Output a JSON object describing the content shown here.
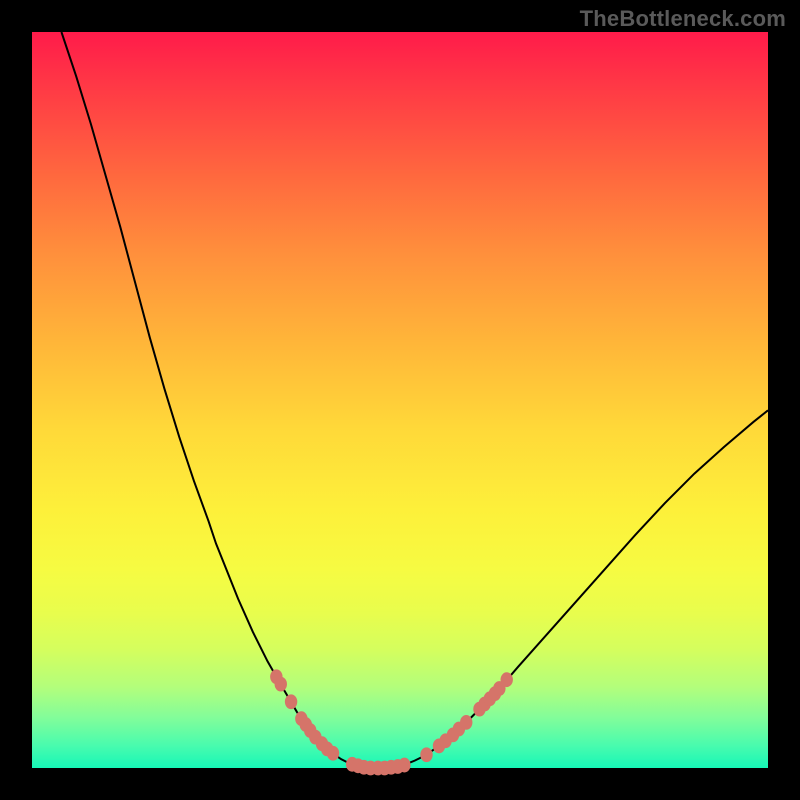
{
  "watermark": "TheBottleneck.com",
  "colors": {
    "marker": "#d57469",
    "curve": "#000000",
    "frame_bg_top": "#ff1b4a",
    "frame_bg_bottom": "#16f7b7",
    "page_bg": "#000000"
  },
  "chart_data": {
    "type": "line",
    "title": "",
    "xlabel": "",
    "ylabel": "",
    "xlim": [
      0,
      100
    ],
    "ylim": [
      0,
      100
    ],
    "grid": false,
    "curve_points": [
      {
        "x": 4.0,
        "y": 100.0
      },
      {
        "x": 6.0,
        "y": 94.0
      },
      {
        "x": 8.0,
        "y": 87.5
      },
      {
        "x": 10.0,
        "y": 80.5
      },
      {
        "x": 12.0,
        "y": 73.5
      },
      {
        "x": 14.0,
        "y": 66.0
      },
      {
        "x": 16.0,
        "y": 58.5
      },
      {
        "x": 18.0,
        "y": 51.5
      },
      {
        "x": 20.0,
        "y": 45.0
      },
      {
        "x": 22.0,
        "y": 39.0
      },
      {
        "x": 24.0,
        "y": 33.5
      },
      {
        "x": 25.0,
        "y": 30.5
      },
      {
        "x": 26.0,
        "y": 28.0
      },
      {
        "x": 28.0,
        "y": 23.0
      },
      {
        "x": 30.0,
        "y": 18.5
      },
      {
        "x": 32.0,
        "y": 14.5
      },
      {
        "x": 34.0,
        "y": 11.0
      },
      {
        "x": 35.0,
        "y": 9.3
      },
      {
        "x": 36.0,
        "y": 7.6
      },
      {
        "x": 37.0,
        "y": 6.2
      },
      {
        "x": 38.0,
        "y": 4.8
      },
      {
        "x": 39.0,
        "y": 3.7
      },
      {
        "x": 40.0,
        "y": 2.7
      },
      {
        "x": 41.0,
        "y": 1.9
      },
      {
        "x": 42.0,
        "y": 1.2
      },
      {
        "x": 43.0,
        "y": 0.7
      },
      {
        "x": 44.0,
        "y": 0.3
      },
      {
        "x": 45.0,
        "y": 0.1
      },
      {
        "x": 46.0,
        "y": 0.0
      },
      {
        "x": 47.5,
        "y": 0.0
      },
      {
        "x": 49.0,
        "y": 0.1
      },
      {
        "x": 50.0,
        "y": 0.3
      },
      {
        "x": 51.0,
        "y": 0.6
      },
      {
        "x": 52.0,
        "y": 1.0
      },
      {
        "x": 53.0,
        "y": 1.5
      },
      {
        "x": 54.0,
        "y": 2.1
      },
      {
        "x": 55.0,
        "y": 2.8
      },
      {
        "x": 57.0,
        "y": 4.4
      },
      {
        "x": 58.0,
        "y": 5.3
      },
      {
        "x": 59.0,
        "y": 6.2
      },
      {
        "x": 60.0,
        "y": 7.2
      },
      {
        "x": 61.0,
        "y": 8.2
      },
      {
        "x": 62.0,
        "y": 9.2
      },
      {
        "x": 63.0,
        "y": 10.2
      },
      {
        "x": 66.0,
        "y": 13.7
      },
      {
        "x": 70.0,
        "y": 18.2
      },
      {
        "x": 74.0,
        "y": 22.7
      },
      {
        "x": 78.0,
        "y": 27.2
      },
      {
        "x": 82.0,
        "y": 31.7
      },
      {
        "x": 86.0,
        "y": 36.0
      },
      {
        "x": 90.0,
        "y": 40.0
      },
      {
        "x": 94.0,
        "y": 43.6
      },
      {
        "x": 98.0,
        "y": 47.0
      },
      {
        "x": 100.0,
        "y": 48.6
      }
    ],
    "marker_clusters": [
      {
        "side": "left",
        "points": [
          {
            "x": 33.2,
            "y": 12.4
          },
          {
            "x": 33.8,
            "y": 11.4
          },
          {
            "x": 35.2,
            "y": 9.0
          },
          {
            "x": 36.6,
            "y": 6.7
          },
          {
            "x": 37.2,
            "y": 5.9
          },
          {
            "x": 37.8,
            "y": 5.1
          },
          {
            "x": 38.5,
            "y": 4.2
          },
          {
            "x": 39.4,
            "y": 3.3
          },
          {
            "x": 40.1,
            "y": 2.6
          },
          {
            "x": 40.9,
            "y": 2.0
          }
        ]
      },
      {
        "side": "bottom",
        "points": [
          {
            "x": 43.5,
            "y": 0.5
          },
          {
            "x": 44.3,
            "y": 0.3
          },
          {
            "x": 45.1,
            "y": 0.1
          },
          {
            "x": 46.0,
            "y": 0.0
          },
          {
            "x": 47.0,
            "y": 0.0
          },
          {
            "x": 47.9,
            "y": 0.0
          },
          {
            "x": 48.8,
            "y": 0.1
          },
          {
            "x": 49.7,
            "y": 0.2
          },
          {
            "x": 50.6,
            "y": 0.4
          }
        ]
      },
      {
        "side": "right",
        "points": [
          {
            "x": 53.6,
            "y": 1.8
          },
          {
            "x": 55.3,
            "y": 3.0
          },
          {
            "x": 56.2,
            "y": 3.7
          },
          {
            "x": 57.2,
            "y": 4.5
          },
          {
            "x": 58.0,
            "y": 5.3
          },
          {
            "x": 59.0,
            "y": 6.2
          }
        ]
      },
      {
        "side": "right-upper",
        "points": [
          {
            "x": 60.8,
            "y": 8.0
          },
          {
            "x": 61.5,
            "y": 8.7
          },
          {
            "x": 62.2,
            "y": 9.4
          },
          {
            "x": 62.9,
            "y": 10.1
          },
          {
            "x": 63.5,
            "y": 10.8
          },
          {
            "x": 64.5,
            "y": 12.0
          }
        ]
      }
    ]
  }
}
